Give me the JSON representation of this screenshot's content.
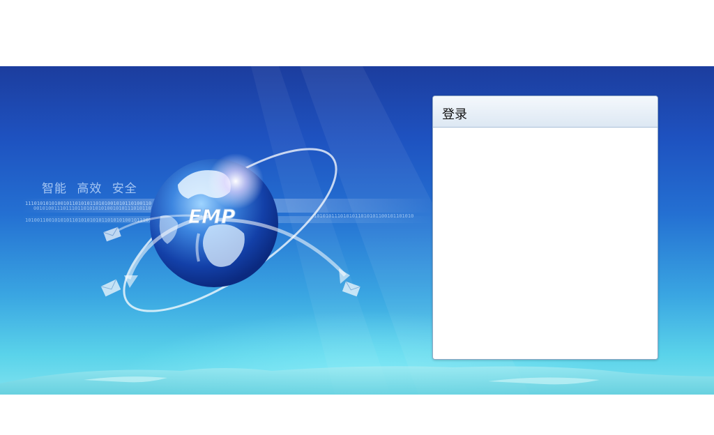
{
  "banner": {
    "slogan": "智能  高效  安全",
    "logo_text": "EMP",
    "binary_row_1": "1110101010100101101010110101001010110100110",
    "binary_row_2": "0010100111011101101010101001010111010110100",
    "binary_row_3": "1010011001010101101010101011010101001011101",
    "binary_row_right": "1010101110101011010101100101101010"
  },
  "login": {
    "title": "登录"
  },
  "colors": {
    "sky_top": "#1c3d9e",
    "sky_bottom": "#7fe2ef",
    "panel_border": "#8fa7c4",
    "header_gradient_top": "#f4f8fc",
    "header_gradient_bottom": "#dde8f3"
  }
}
